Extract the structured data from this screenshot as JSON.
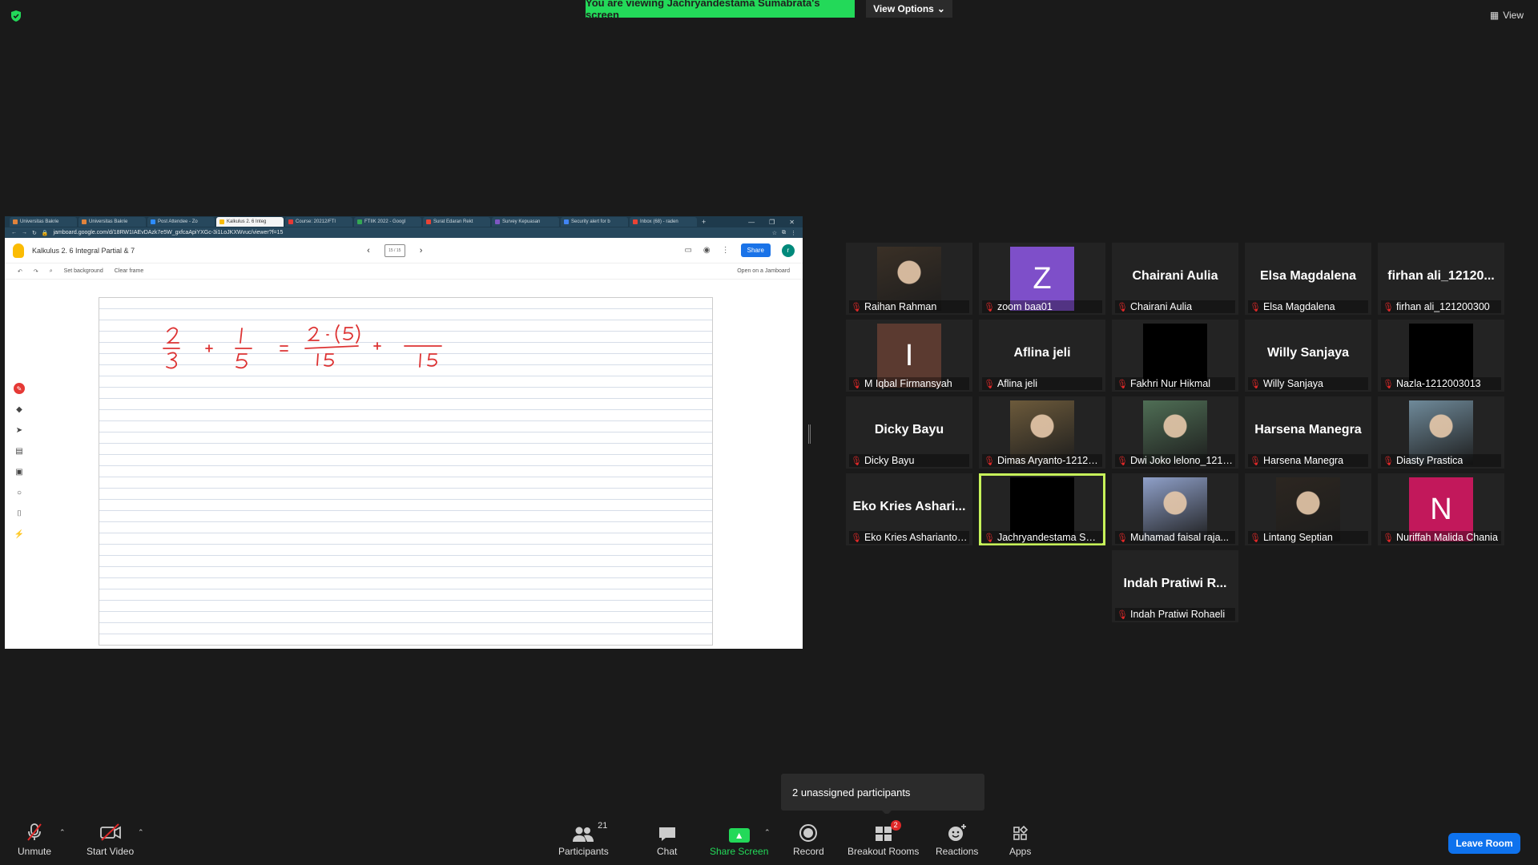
{
  "top": {
    "banner": "You are viewing Jachryandestama Sumabrata's screen",
    "view_options": "View Options",
    "view": "View"
  },
  "shared_screen": {
    "tabs": [
      {
        "label": "Universitas Bakrie"
      },
      {
        "label": "Universitas Bakrie"
      },
      {
        "label": "Post Attendee - Zo"
      },
      {
        "label": "Kalkulus 2. 6 Integ",
        "active": true
      },
      {
        "label": "Course: 20212/FTI"
      },
      {
        "label": "FTIIK 2022 - Googl"
      },
      {
        "label": "Surat Edaran Rekt"
      },
      {
        "label": "Survey Kepuasan"
      },
      {
        "label": "Security alert for b"
      },
      {
        "label": "Inbox (68) - raden"
      }
    ],
    "url": "jamboard.google.com/d/18RW1IAEvDAzk7e5W_gxfcaApiYXGc-3i1LoJKXWvuc/viewer?f=15",
    "jam_title": "Kalkulus 2. 6 Integral Partial & 7",
    "share": "Share",
    "avatar_letter": "r",
    "tools": {
      "set_background": "Set background",
      "clear_frame": "Clear frame",
      "open_on_jamboard": "Open on a Jamboard"
    },
    "frame_indicator": "15 / 15"
  },
  "participants": [
    {
      "name": "Raihan Rahman",
      "kind": "photo",
      "color": "#3a3026"
    },
    {
      "name": "zoom baa01",
      "kind": "letter",
      "letter": "Z",
      "color": "#7e4fc9"
    },
    {
      "name": "Chairani Aulia",
      "kind": "name",
      "big": "Chairani Aulia"
    },
    {
      "name": "Elsa Magdalena",
      "kind": "name",
      "big": "Elsa Magdalena"
    },
    {
      "name": "firhan ali_121200300",
      "kind": "name",
      "big": "firhan ali_12120..."
    },
    {
      "name": "M Iqbal Firmansyah",
      "kind": "letter",
      "letter": "I",
      "color": "#5b3a30"
    },
    {
      "name": "Aflina jeli",
      "kind": "name",
      "big": "Aflina jeli"
    },
    {
      "name": "Fakhri Nur Hikmal",
      "kind": "black"
    },
    {
      "name": "Willy Sanjaya",
      "kind": "name",
      "big": "Willy Sanjaya"
    },
    {
      "name": "Nazla-1212003013",
      "kind": "black"
    },
    {
      "name": "Dicky Bayu",
      "kind": "name",
      "big": "Dicky Bayu"
    },
    {
      "name": "Dimas Aryanto-1212003...",
      "kind": "photo",
      "color": "#6c5a3b"
    },
    {
      "name": "Dwi Joko lelono_1212...",
      "kind": "photo",
      "color": "#4f6e55"
    },
    {
      "name": "Harsena Manegra",
      "kind": "name",
      "big": "Harsena Manegra"
    },
    {
      "name": "Diasty Prastica",
      "kind": "photo",
      "color": "#6f8a9a"
    },
    {
      "name": "Eko Kries Asharianto ...",
      "kind": "name",
      "big": "Eko Kries Ashari..."
    },
    {
      "name": "Jachryandestama Sumab...",
      "kind": "black",
      "active": true
    },
    {
      "name": "Muhamad faisal raja...",
      "kind": "photo",
      "color": "#8fa0c9"
    },
    {
      "name": "Lintang Septian",
      "kind": "photo",
      "color": "#2c2620"
    },
    {
      "name": "Nuriffah Malida Chania",
      "kind": "letter",
      "letter": "N",
      "color": "#c2185b"
    },
    {
      "name": "Indah Pratiwi Rohaeli",
      "kind": "name",
      "big": "Indah Pratiwi R..."
    }
  ],
  "popover": "2 unassigned participants",
  "toolbar": {
    "unmute": "Unmute",
    "start_video": "Start Video",
    "participants": "Participants",
    "participants_count": "21",
    "chat": "Chat",
    "share_screen": "Share Screen",
    "record": "Record",
    "breakout_rooms": "Breakout Rooms",
    "breakout_badge": "2",
    "reactions": "Reactions",
    "apps": "Apps",
    "leave_room": "Leave Room"
  },
  "colors": {
    "banner": "#23d959",
    "leave": "#0e72ed",
    "active_speaker": "#c7f35a",
    "mic_muted": "#e02828"
  }
}
